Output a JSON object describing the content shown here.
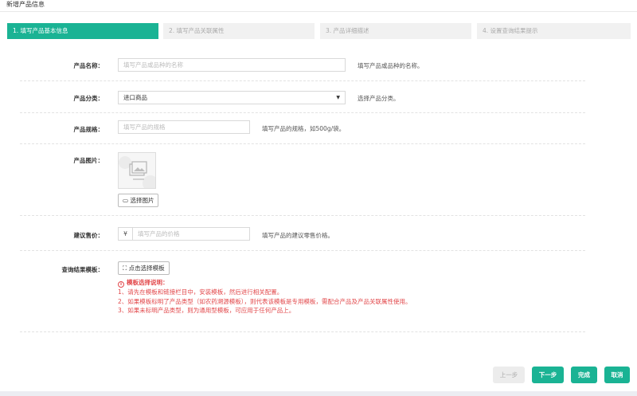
{
  "page_title": "新增产品信息",
  "steps": [
    {
      "label": "1. 填写产品基本信息",
      "active": true
    },
    {
      "label": "2. 填写产品关联属性",
      "active": false
    },
    {
      "label": "3. 产品详细描述",
      "active": false
    },
    {
      "label": "4. 设置查询结果提示",
      "active": false
    }
  ],
  "form": {
    "name": {
      "label": "产品名称：",
      "placeholder": "填写产品或品种的名称",
      "hint": "填写产品或品种的名称。"
    },
    "category": {
      "label": "产品分类：",
      "value": "进口商品",
      "hint": "选择产品分类。"
    },
    "spec": {
      "label": "产品规格：",
      "placeholder": "填写产品的规格",
      "hint": "填写产品的规格，如500g/袋。"
    },
    "image": {
      "label": "产品图片：",
      "button": "选择图片"
    },
    "price": {
      "label": "建议售价：",
      "currency": "¥",
      "placeholder": "填写产品的价格",
      "hint": "填写产品的建议零售价格。"
    },
    "template": {
      "label": "查询结果模板：",
      "button": "点击选择模板",
      "notes_title": "模板选择说明：",
      "notes": [
        "1、请先在模板和链接栏目中，安装模板，然后进行相关配置。",
        "2、如果模板标明了产品类型（如农药溯源模板），则代表该模板是专用模板，需配合产品及产品关联属性使用。",
        "3、如果未标明产品类型，则为通用型模板，可应用于任何产品上。"
      ]
    }
  },
  "footer": {
    "prev": "上一步",
    "next": "下一步",
    "done": "完成",
    "cancel": "取消"
  },
  "colors": {
    "accent": "#1ab394",
    "warning": "#e2474a"
  }
}
